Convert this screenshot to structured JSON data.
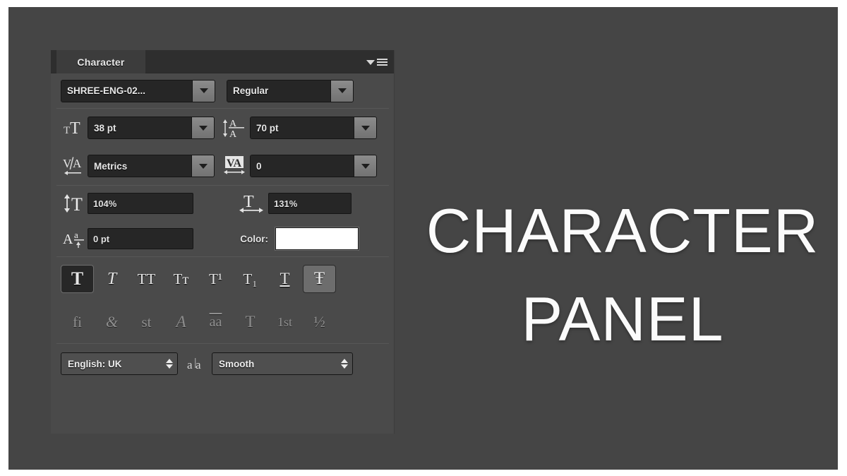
{
  "theme": {
    "canvas_bg": "#454545",
    "panel_bg": "#4a4a4a",
    "header_bg": "#2e2e2e",
    "field_bg": "#262626",
    "text": "#e8e8e8",
    "swatch_color": "#ffffff"
  },
  "panel": {
    "tab_label": "Character",
    "menu_icon": "panel-menu-icon",
    "font_family": {
      "icon": "font-family-field",
      "value": "SHREE-ENG-02...",
      "caret": "chevron-down-icon"
    },
    "font_style": {
      "value": "Regular",
      "caret": "chevron-down-icon"
    },
    "font_size": {
      "icon": "font-size-icon",
      "value": "38 pt",
      "caret": "chevron-down-icon"
    },
    "leading": {
      "icon": "leading-icon",
      "value": "70 pt",
      "caret": "chevron-down-icon"
    },
    "kerning": {
      "icon": "kerning-icon",
      "value": "Metrics",
      "caret": "chevron-down-icon"
    },
    "tracking": {
      "icon": "tracking-icon",
      "value": "0",
      "caret": "chevron-down-icon"
    },
    "vertical_scale": {
      "icon": "vertical-scale-icon",
      "value": "104%"
    },
    "horizontal_scale": {
      "icon": "horizontal-scale-icon",
      "value": "131%"
    },
    "baseline_shift": {
      "icon": "baseline-shift-icon",
      "value": "0 pt"
    },
    "color": {
      "label": "Color:",
      "swatch": "#ffffff"
    },
    "style_buttons": [
      {
        "name": "faux-bold-button",
        "glyph": "T",
        "state": "active-dark"
      },
      {
        "name": "faux-italic-button",
        "glyph": "T",
        "state": "off"
      },
      {
        "name": "all-caps-button",
        "glyph": "TT",
        "state": "off"
      },
      {
        "name": "small-caps-button",
        "glyph": "Tт",
        "state": "off"
      },
      {
        "name": "superscript-button",
        "glyph": "T¹",
        "state": "off"
      },
      {
        "name": "subscript-button",
        "glyph": "T₁",
        "state": "off"
      },
      {
        "name": "underline-button",
        "glyph": "T",
        "state": "off"
      },
      {
        "name": "strikethrough-button",
        "glyph": "Ŧ",
        "state": "active-light"
      }
    ],
    "opentype_buttons": [
      {
        "name": "standard-ligatures-button",
        "glyph": "fi"
      },
      {
        "name": "contextual-alternates-button",
        "glyph": "&"
      },
      {
        "name": "discretionary-ligatures-button",
        "glyph": "st"
      },
      {
        "name": "swash-button",
        "glyph": "A"
      },
      {
        "name": "stylistic-alternates-button",
        "glyph": "aa"
      },
      {
        "name": "titling-alternates-button",
        "glyph": "T"
      },
      {
        "name": "ordinals-button",
        "glyph": "1st"
      },
      {
        "name": "fractions-button",
        "glyph": "½"
      }
    ],
    "language": {
      "value": "English: UK",
      "stepper": "up-down-arrows-icon"
    },
    "antialias_icon": "anti-aliasing-icon",
    "antialias": {
      "value": "Smooth",
      "stepper": "up-down-arrows-icon"
    }
  },
  "headline": {
    "line1": "CHARACTER",
    "line2": "PANEL"
  }
}
